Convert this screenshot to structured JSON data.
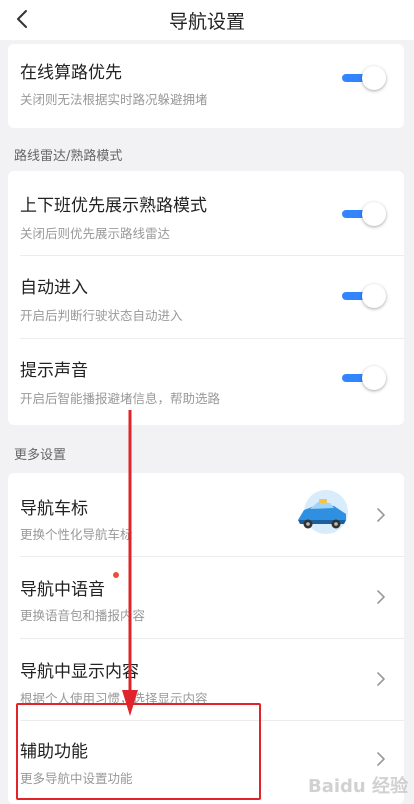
{
  "header": {
    "title": "导航设置"
  },
  "online": {
    "title": "在线算路优先",
    "subtitle": "关闭则无法根据实时路况躲避拥堵",
    "enabled": true
  },
  "section_radar": {
    "label": "路线雷达/熟路模式",
    "items": [
      {
        "title": "上下班优先展示熟路模式",
        "subtitle": "关闭后则优先展示路线雷达",
        "enabled": true
      },
      {
        "title": "自动进入",
        "subtitle": "开启后判断行驶状态自动进入",
        "enabled": true
      },
      {
        "title": "提示声音",
        "subtitle": "开启后智能播报避堵信息，帮助选路",
        "enabled": true
      }
    ]
  },
  "section_more": {
    "label": "更多设置",
    "items": [
      {
        "title": "导航车标",
        "subtitle": "更换个性化导航车标"
      },
      {
        "title": "导航中语音",
        "subtitle": "更换语音包和播报内容"
      },
      {
        "title": "导航中显示内容",
        "subtitle": "根据个人使用习惯，选择显示内容"
      },
      {
        "title": "辅助功能",
        "subtitle": "更多导航中设置功能"
      }
    ]
  },
  "watermark": {
    "text": "Baidu 经验"
  },
  "colors": {
    "accent": "#3385ff",
    "annotation": "#e0242b",
    "dot": "#f04b3c"
  }
}
